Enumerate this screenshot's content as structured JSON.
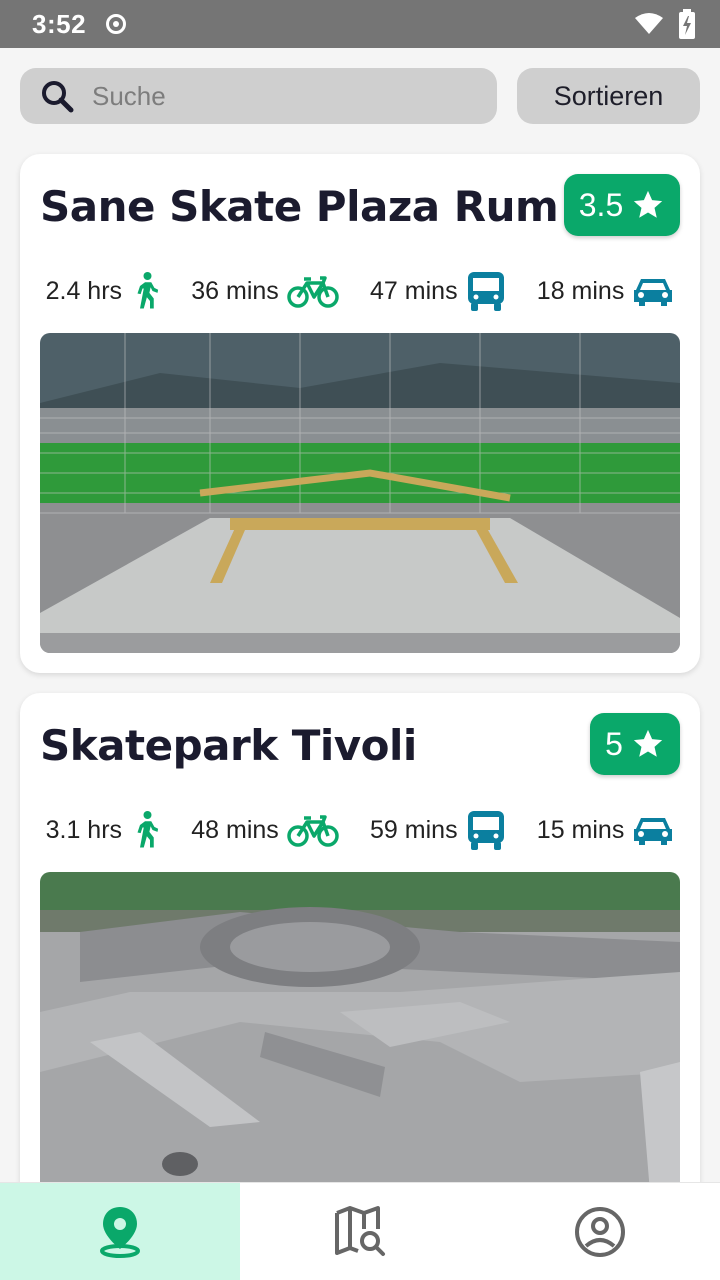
{
  "status": {
    "time": "3:52"
  },
  "search": {
    "placeholder": "Suche"
  },
  "sort": {
    "label": "Sortieren"
  },
  "colors": {
    "accent": "#0aa86a",
    "icon_green": "#0aa86a",
    "icon_blue": "#0b7f9f"
  },
  "parks": [
    {
      "name": "Sane Skate Plaza Rum",
      "rating": "3.5",
      "walk": "2.4 hrs",
      "bike": "36 mins",
      "bus": "47 mins",
      "car": "18 mins"
    },
    {
      "name": "Skatepark Tivoli",
      "rating": "5",
      "walk": "3.1 hrs",
      "bike": "48 mins",
      "bus": "59 mins",
      "car": "15 mins"
    }
  ],
  "nav": {
    "items": [
      {
        "icon": "location-pin-icon",
        "active": true
      },
      {
        "icon": "map-search-icon",
        "active": false
      },
      {
        "icon": "account-icon",
        "active": false
      }
    ]
  }
}
